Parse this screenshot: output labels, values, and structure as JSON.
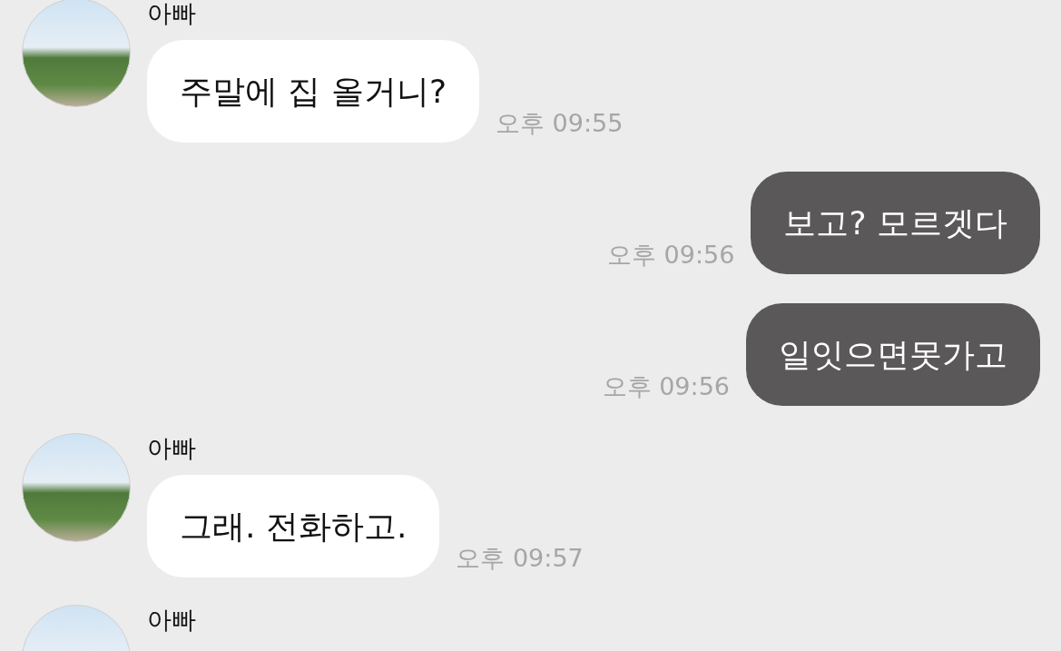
{
  "messages": [
    {
      "kind": "received",
      "sender": "아빠",
      "text": "주말에 집 올거니?",
      "time": "오후 09:55"
    },
    {
      "kind": "sent",
      "text": "보고? 모르겟다",
      "time": "오후 09:56"
    },
    {
      "kind": "sent",
      "text": "일잇으면못가고",
      "time": "오후 09:56"
    },
    {
      "kind": "received",
      "sender": "아빠",
      "text": "그래. 전화하고.",
      "time": "오후 09:57"
    },
    {
      "kind": "received",
      "sender": "아빠"
    }
  ]
}
